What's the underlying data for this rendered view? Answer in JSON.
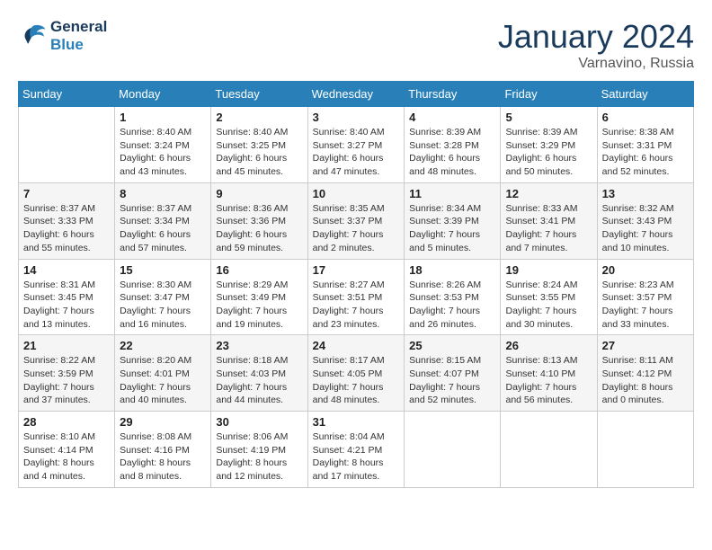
{
  "header": {
    "logo_line1": "General",
    "logo_line2": "Blue",
    "month": "January 2024",
    "location": "Varnavino, Russia"
  },
  "weekdays": [
    "Sunday",
    "Monday",
    "Tuesday",
    "Wednesday",
    "Thursday",
    "Friday",
    "Saturday"
  ],
  "weeks": [
    [
      {
        "day": "",
        "info": ""
      },
      {
        "day": "1",
        "info": "Sunrise: 8:40 AM\nSunset: 3:24 PM\nDaylight: 6 hours\nand 43 minutes."
      },
      {
        "day": "2",
        "info": "Sunrise: 8:40 AM\nSunset: 3:25 PM\nDaylight: 6 hours\nand 45 minutes."
      },
      {
        "day": "3",
        "info": "Sunrise: 8:40 AM\nSunset: 3:27 PM\nDaylight: 6 hours\nand 47 minutes."
      },
      {
        "day": "4",
        "info": "Sunrise: 8:39 AM\nSunset: 3:28 PM\nDaylight: 6 hours\nand 48 minutes."
      },
      {
        "day": "5",
        "info": "Sunrise: 8:39 AM\nSunset: 3:29 PM\nDaylight: 6 hours\nand 50 minutes."
      },
      {
        "day": "6",
        "info": "Sunrise: 8:38 AM\nSunset: 3:31 PM\nDaylight: 6 hours\nand 52 minutes."
      }
    ],
    [
      {
        "day": "7",
        "info": "Sunrise: 8:37 AM\nSunset: 3:33 PM\nDaylight: 6 hours\nand 55 minutes."
      },
      {
        "day": "8",
        "info": "Sunrise: 8:37 AM\nSunset: 3:34 PM\nDaylight: 6 hours\nand 57 minutes."
      },
      {
        "day": "9",
        "info": "Sunrise: 8:36 AM\nSunset: 3:36 PM\nDaylight: 6 hours\nand 59 minutes."
      },
      {
        "day": "10",
        "info": "Sunrise: 8:35 AM\nSunset: 3:37 PM\nDaylight: 7 hours\nand 2 minutes."
      },
      {
        "day": "11",
        "info": "Sunrise: 8:34 AM\nSunset: 3:39 PM\nDaylight: 7 hours\nand 5 minutes."
      },
      {
        "day": "12",
        "info": "Sunrise: 8:33 AM\nSunset: 3:41 PM\nDaylight: 7 hours\nand 7 minutes."
      },
      {
        "day": "13",
        "info": "Sunrise: 8:32 AM\nSunset: 3:43 PM\nDaylight: 7 hours\nand 10 minutes."
      }
    ],
    [
      {
        "day": "14",
        "info": "Sunrise: 8:31 AM\nSunset: 3:45 PM\nDaylight: 7 hours\nand 13 minutes."
      },
      {
        "day": "15",
        "info": "Sunrise: 8:30 AM\nSunset: 3:47 PM\nDaylight: 7 hours\nand 16 minutes."
      },
      {
        "day": "16",
        "info": "Sunrise: 8:29 AM\nSunset: 3:49 PM\nDaylight: 7 hours\nand 19 minutes."
      },
      {
        "day": "17",
        "info": "Sunrise: 8:27 AM\nSunset: 3:51 PM\nDaylight: 7 hours\nand 23 minutes."
      },
      {
        "day": "18",
        "info": "Sunrise: 8:26 AM\nSunset: 3:53 PM\nDaylight: 7 hours\nand 26 minutes."
      },
      {
        "day": "19",
        "info": "Sunrise: 8:24 AM\nSunset: 3:55 PM\nDaylight: 7 hours\nand 30 minutes."
      },
      {
        "day": "20",
        "info": "Sunrise: 8:23 AM\nSunset: 3:57 PM\nDaylight: 7 hours\nand 33 minutes."
      }
    ],
    [
      {
        "day": "21",
        "info": "Sunrise: 8:22 AM\nSunset: 3:59 PM\nDaylight: 7 hours\nand 37 minutes."
      },
      {
        "day": "22",
        "info": "Sunrise: 8:20 AM\nSunset: 4:01 PM\nDaylight: 7 hours\nand 40 minutes."
      },
      {
        "day": "23",
        "info": "Sunrise: 8:18 AM\nSunset: 4:03 PM\nDaylight: 7 hours\nand 44 minutes."
      },
      {
        "day": "24",
        "info": "Sunrise: 8:17 AM\nSunset: 4:05 PM\nDaylight: 7 hours\nand 48 minutes."
      },
      {
        "day": "25",
        "info": "Sunrise: 8:15 AM\nSunset: 4:07 PM\nDaylight: 7 hours\nand 52 minutes."
      },
      {
        "day": "26",
        "info": "Sunrise: 8:13 AM\nSunset: 4:10 PM\nDaylight: 7 hours\nand 56 minutes."
      },
      {
        "day": "27",
        "info": "Sunrise: 8:11 AM\nSunset: 4:12 PM\nDaylight: 8 hours\nand 0 minutes."
      }
    ],
    [
      {
        "day": "28",
        "info": "Sunrise: 8:10 AM\nSunset: 4:14 PM\nDaylight: 8 hours\nand 4 minutes."
      },
      {
        "day": "29",
        "info": "Sunrise: 8:08 AM\nSunset: 4:16 PM\nDaylight: 8 hours\nand 8 minutes."
      },
      {
        "day": "30",
        "info": "Sunrise: 8:06 AM\nSunset: 4:19 PM\nDaylight: 8 hours\nand 12 minutes."
      },
      {
        "day": "31",
        "info": "Sunrise: 8:04 AM\nSunset: 4:21 PM\nDaylight: 8 hours\nand 17 minutes."
      },
      {
        "day": "",
        "info": ""
      },
      {
        "day": "",
        "info": ""
      },
      {
        "day": "",
        "info": ""
      }
    ]
  ]
}
